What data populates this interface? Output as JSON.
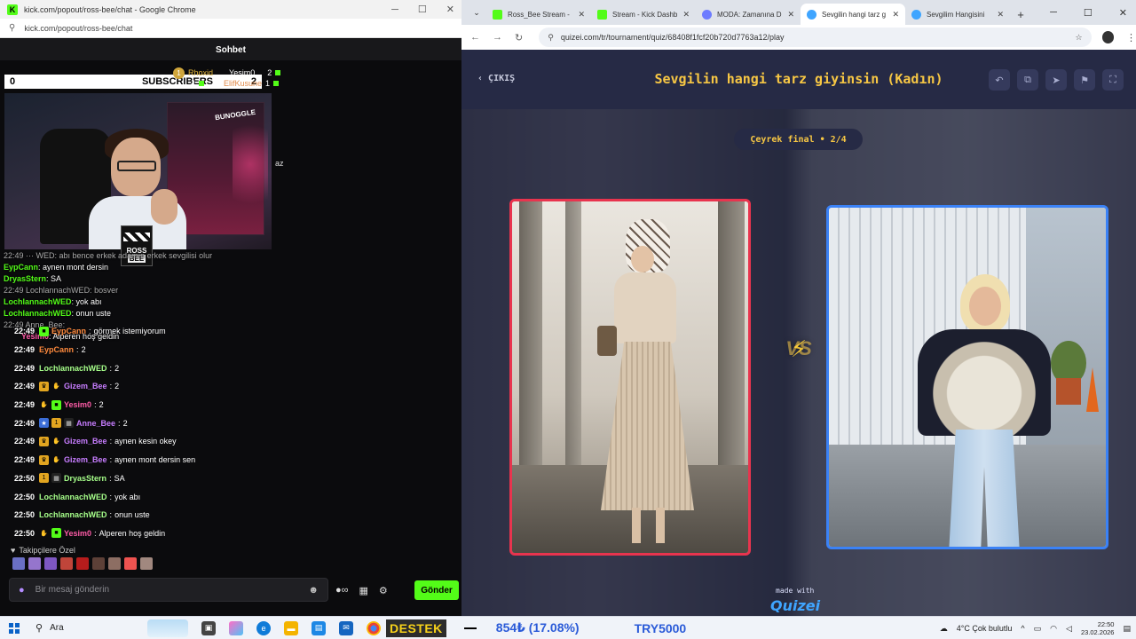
{
  "left_window": {
    "title": "kick.com/popout/ross-bee/chat - Google Chrome",
    "url": "kick.com/popout/ross-bee/chat",
    "chat_header": "Sohbet",
    "subs_bar": {
      "left_value": "0",
      "label": "SUBSCRIBERS",
      "right_value": "2"
    },
    "gifters": [
      {
        "name": "Rhoxid",
        "count": "4"
      },
      {
        "name": "Yesim0",
        "count": "2"
      },
      {
        "name": "ElifKusune",
        "count": "1"
      }
    ],
    "webcam_sign": "BUNOGGLE",
    "webcam_logo": {
      "line1": "ROSS",
      "line2": "BEE"
    },
    "cut_text": "az",
    "overlay_messages": [
      {
        "user": "EypCann",
        "text": ": aynen mont dersin"
      },
      {
        "user": "DryasStern",
        "text": ": SA"
      },
      {
        "user": "LochlannachWED",
        "text": ": yok abı"
      },
      {
        "user": "LochlannachWED",
        "text": ": onun uste"
      },
      {
        "user": "Yesim0",
        "text": ": Alperen hoş geldin"
      }
    ],
    "overlay_underlay": [
      "22:49 ··· WED: abı bence erkek adamın erkek sevgilisi olur",
      "22:49 LochlannachWED: bosver",
      "22:49 Anne_Bee:"
    ],
    "messages": [
      {
        "time": "22:49",
        "badges": [
          "green"
        ],
        "user": "EypCann",
        "color": "#ff8a3d",
        "text": "görmek istemiyorum"
      },
      {
        "time": "22:49",
        "badges": [],
        "user": "EypCann",
        "color": "#ff8a3d",
        "text": "2"
      },
      {
        "time": "22:49",
        "badges": [],
        "user": "LochlannachWED",
        "color": "#a6ff8a",
        "text": "2"
      },
      {
        "time": "22:49",
        "badges": [
          "crown",
          "gift"
        ],
        "user": "Gizem_Bee",
        "color": "#c77dff",
        "text": "2"
      },
      {
        "time": "22:49",
        "badges": [
          "gift",
          "green"
        ],
        "user": "Yesim0",
        "color": "#ff5ca8",
        "text": "2"
      },
      {
        "time": "22:49",
        "badges": [
          "sub",
          "coin",
          "clap"
        ],
        "user": "Anne_Bee",
        "color": "#c77dff",
        "text": "2"
      },
      {
        "time": "22:49",
        "badges": [
          "crown",
          "gift"
        ],
        "user": "Gizem_Bee",
        "color": "#c77dff",
        "text": "aynen kesin okey"
      },
      {
        "time": "22:49",
        "badges": [
          "crown",
          "gift"
        ],
        "user": "Gizem_Bee",
        "color": "#c77dff",
        "text": "aynen mont dersin sen"
      },
      {
        "time": "22:50",
        "badges": [
          "coin",
          "clap"
        ],
        "user": "DryasStern",
        "color": "#a6ff8a",
        "text": "SA"
      },
      {
        "time": "22:50",
        "badges": [],
        "user": "LochlannachWED",
        "color": "#a6ff8a",
        "text": "yok abı"
      },
      {
        "time": "22:50",
        "badges": [],
        "user": "LochlannachWED",
        "color": "#a6ff8a",
        "text": "onun uste"
      },
      {
        "time": "22:50",
        "badges": [
          "gift",
          "green"
        ],
        "user": "Yesim0",
        "color": "#ff5ca8",
        "text": "Alperen hoş geldin"
      }
    ],
    "followers_label": "Takipçilere Özel",
    "input_placeholder": "Bir mesaj gönderin",
    "send_label": "Gönder"
  },
  "right_window": {
    "tabs": [
      {
        "label": "Ross_Bee Stream - ",
        "icon_color": "#53fc18",
        "active": false
      },
      {
        "label": "Stream - Kick Dashb",
        "icon_color": "#53fc18",
        "active": false
      },
      {
        "label": "MODA: Zamanına D",
        "icon_color": "#6d7cff",
        "active": false
      },
      {
        "label": "Sevgilin hangi tarz g",
        "icon_color": "#3fa5ff",
        "active": true
      },
      {
        "label": "Sevgilim Hangisini",
        "icon_color": "#3fa5ff",
        "active": false
      }
    ],
    "url": "quizei.com/tr/tournament/quiz/68408f1fcf20b720d7763a12/play",
    "exit_label": "ÇIKIŞ",
    "quiz_title": "Sevgilin hangi tarz giyinsin (Kadın)",
    "round_label": "Çeyrek final • 2/4",
    "vs_label": "VS",
    "made_with": "made with",
    "brand": "Quizei"
  },
  "taskbar": {
    "search_label": "Ara",
    "destek_label": "DESTEK",
    "ticker_price": "854₺ (17.08%)",
    "ticker_goal": "TRY5000",
    "weather": "4°C  Çok bulutlu",
    "time": "22:50",
    "date": "23.02.2026"
  },
  "colors": {
    "kick_green": "#53fc18",
    "quiz_gold": "#f7c744",
    "left_card_border": "#e8344e",
    "right_card_border": "#3b82f6"
  }
}
